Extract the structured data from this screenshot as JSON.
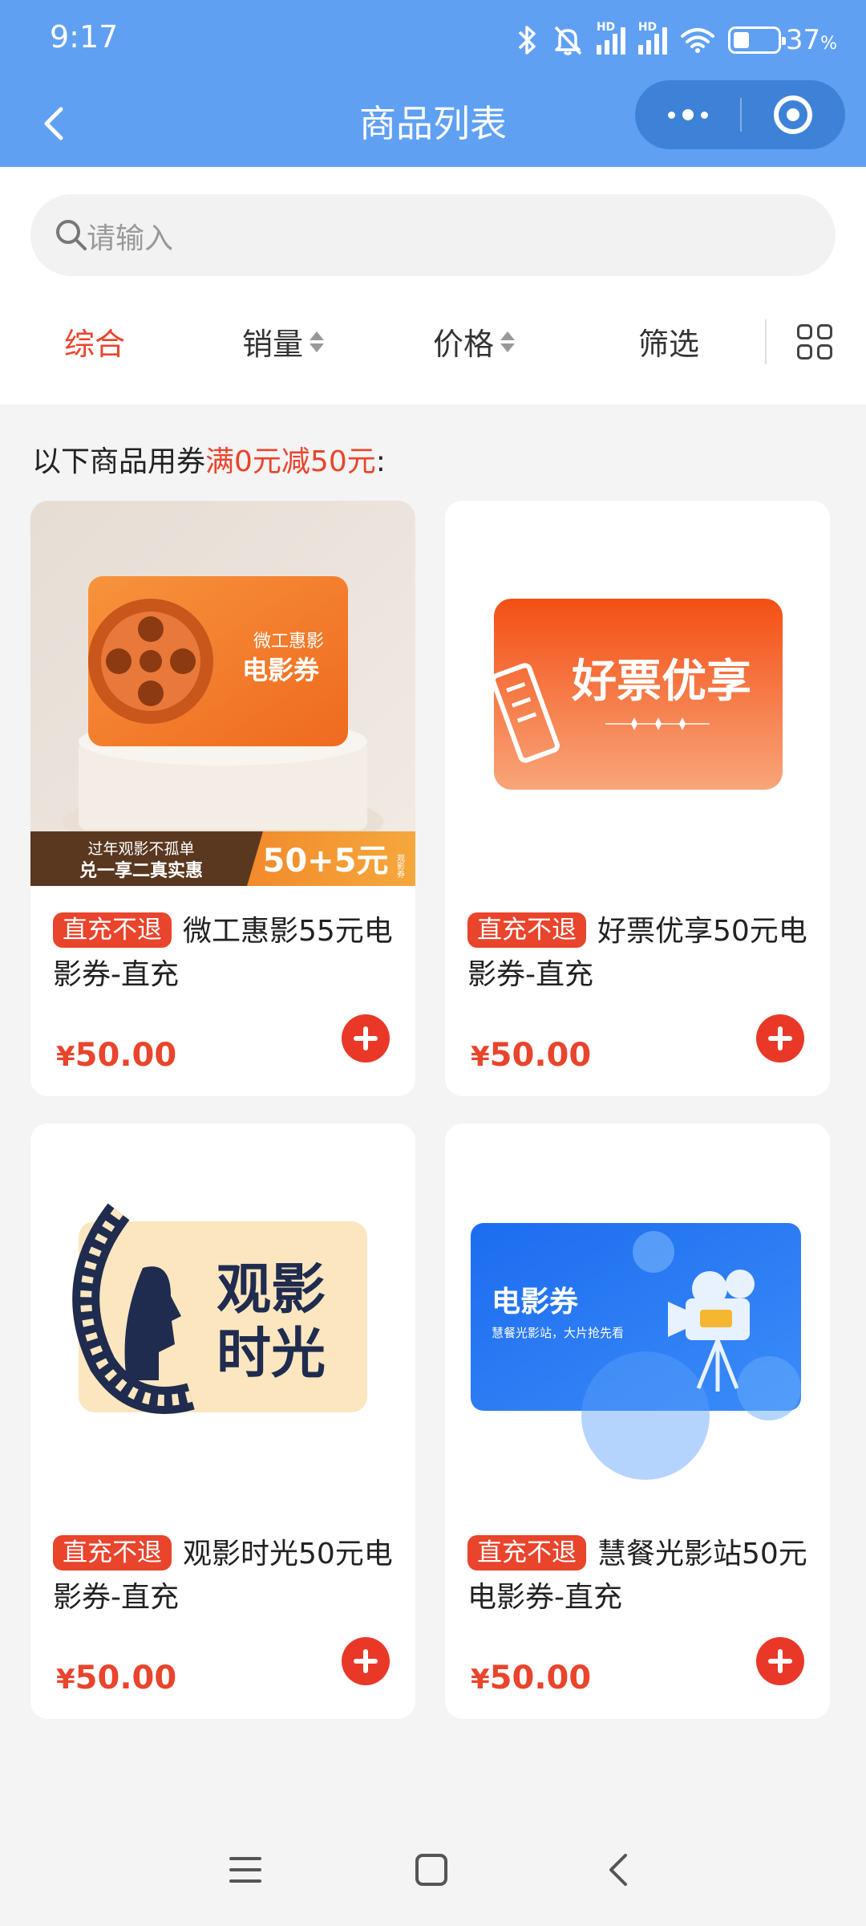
{
  "status_bar": {
    "time": "9:17",
    "hd1": "HD",
    "hd2": "HD",
    "battery_percent": "37",
    "battery_unit": "%",
    "battery_level": 0.37,
    "icons": [
      "bluetooth-icon",
      "mute-bell-icon",
      "signal-icon",
      "signal-icon",
      "wifi-icon",
      "battery-icon"
    ]
  },
  "nav": {
    "title": "商品列表",
    "icons": [
      "back-chevron-icon",
      "more-dots-icon",
      "close-target-icon"
    ]
  },
  "search": {
    "placeholder": "请输入",
    "icon": "search-icon"
  },
  "sort": {
    "items": [
      {
        "label": "综合",
        "active": true
      },
      {
        "label": "销量",
        "sortable": true
      },
      {
        "label": "价格",
        "sortable": true
      },
      {
        "label": "筛选"
      }
    ],
    "layout_toggle_icon": "grid-view-icon"
  },
  "promo": {
    "prefix": "以下商品用券",
    "highlight": "满0元减50元",
    "suffix": ":"
  },
  "products": [
    {
      "tag": "直充不退",
      "name": "微工惠影55元电影券-直充",
      "currency": "¥",
      "price": "50.00",
      "image": {
        "brand_small": "微工惠影",
        "brand_big": "电影券",
        "banner_top": "过年观影不孤单",
        "banner_bottom": "兑一享二真实惠",
        "badge": "50+5元",
        "badge_side": "观影券"
      }
    },
    {
      "tag": "直充不退",
      "name": "好票优享50元电影券-直充",
      "currency": "¥",
      "price": "50.00",
      "image": {
        "text": "好票优享"
      }
    },
    {
      "tag": "直充不退",
      "name": "观影时光50元电影券-直充",
      "currency": "¥",
      "price": "50.00",
      "image": {
        "line1": "观影",
        "line2": "时光"
      }
    },
    {
      "tag": "直充不退",
      "name": "慧餐光影站50元电影券-直充",
      "currency": "¥",
      "price": "50.00",
      "image": {
        "title": "电影券",
        "subtitle": "慧餐光影站，大片抢先看"
      }
    }
  ],
  "colors": {
    "header_bg": "#5fa0f2",
    "accent_red": "#e9442c",
    "page_bg": "#f4f4f4"
  },
  "system_nav": {
    "icons": [
      "menu-lines-icon",
      "home-square-icon",
      "back-chevron-icon"
    ]
  }
}
